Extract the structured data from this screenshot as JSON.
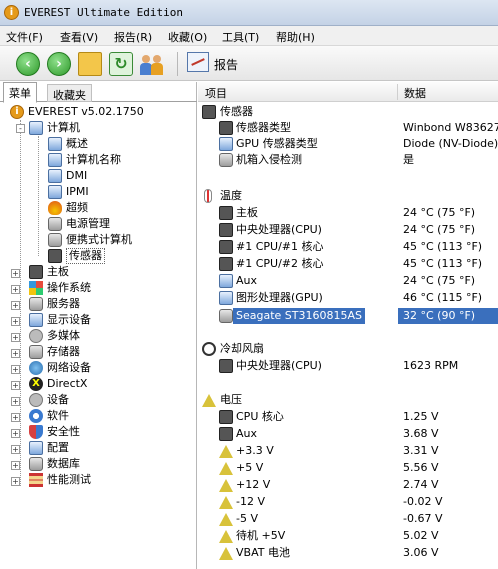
{
  "window": {
    "title": "EVEREST Ultimate Edition"
  },
  "menu": [
    {
      "label": "文件(F)"
    },
    {
      "label": "查看(V)"
    },
    {
      "label": "报告(R)"
    },
    {
      "label": "收藏(O)"
    },
    {
      "label": "工具(T)"
    },
    {
      "label": "帮助(H)"
    }
  ],
  "toolbar": {
    "back_icon": "back-arrow-icon",
    "forward_icon": "forward-arrow-icon",
    "up_icon": "folder-up-icon",
    "refresh_icon": "refresh-icon",
    "users_icon": "users-icon",
    "report_label": "报告"
  },
  "left": {
    "tabs": [
      {
        "label": "菜单"
      },
      {
        "label": "收藏夹"
      }
    ],
    "tree": [
      {
        "label": "EVEREST v5.02.1750"
      },
      {
        "label": "计算机"
      },
      {
        "label": "概述"
      },
      {
        "label": "计算机名称"
      },
      {
        "label": "DMI"
      },
      {
        "label": "IPMI"
      },
      {
        "label": "超频"
      },
      {
        "label": "电源管理"
      },
      {
        "label": "便携式计算机"
      },
      {
        "label": "传感器"
      },
      {
        "label": "主板"
      },
      {
        "label": "操作系统"
      },
      {
        "label": "服务器"
      },
      {
        "label": "显示设备"
      },
      {
        "label": "多媒体"
      },
      {
        "label": "存储器"
      },
      {
        "label": "网络设备"
      },
      {
        "label": "DirectX"
      },
      {
        "label": "设备"
      },
      {
        "label": "软件"
      },
      {
        "label": "安全性"
      },
      {
        "label": "配置"
      },
      {
        "label": "数据库"
      },
      {
        "label": "性能测试"
      }
    ]
  },
  "right": {
    "columns": {
      "item": "项目",
      "data": "数据"
    },
    "rows": [
      {
        "key": "传感器",
        "value": ""
      },
      {
        "key": "传感器类型",
        "value": "Winbond W83627DH"
      },
      {
        "key": "GPU 传感器类型",
        "value": "Diode (NV-Diode)"
      },
      {
        "key": "机箱入侵检测",
        "value": "是"
      },
      {
        "key": "温度",
        "value": ""
      },
      {
        "key": "主板",
        "value": "24 °C (75 °F)"
      },
      {
        "key": "中央处理器(CPU)",
        "value": "24 °C (75 °F)"
      },
      {
        "key": "#1 CPU/#1 核心",
        "value": "45 °C (113 °F)"
      },
      {
        "key": "#1 CPU/#2 核心",
        "value": "45 °C (113 °F)"
      },
      {
        "key": "Aux",
        "value": "24 °C (75 °F)"
      },
      {
        "key": "图形处理器(GPU)",
        "value": "46 °C (115 °F)"
      },
      {
        "key": "Seagate ST3160815AS",
        "value": "32 °C (90 °F)"
      },
      {
        "key": "冷却风扇",
        "value": ""
      },
      {
        "key": "中央处理器(CPU)",
        "value": "1623 RPM"
      },
      {
        "key": "电压",
        "value": ""
      },
      {
        "key": "CPU 核心",
        "value": "1.25 V"
      },
      {
        "key": "Aux",
        "value": "3.68 V"
      },
      {
        "key": "+3.3 V",
        "value": "3.31 V"
      },
      {
        "key": "+5 V",
        "value": "5.56 V"
      },
      {
        "key": "+12 V",
        "value": "2.74 V"
      },
      {
        "key": "-12 V",
        "value": "-0.02 V"
      },
      {
        "key": "-5 V",
        "value": "-0.67 V"
      },
      {
        "key": "待机 +5V",
        "value": "5.02 V"
      },
      {
        "key": "VBAT 电池",
        "value": "3.06 V"
      }
    ]
  }
}
